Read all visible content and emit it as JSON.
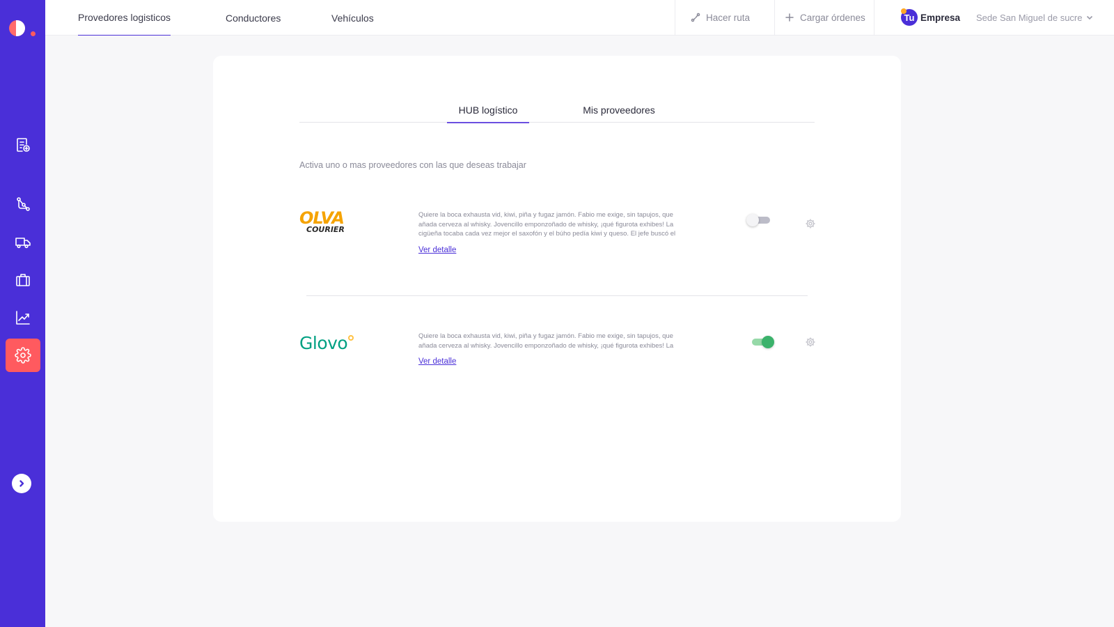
{
  "header": {
    "nav_tabs": [
      {
        "label": "Provedores logisticos",
        "active": true
      },
      {
        "label": "Conductores",
        "active": false
      },
      {
        "label": "Vehículos",
        "active": false
      }
    ],
    "route_label": "Hacer ruta",
    "load_orders_label": "Cargar órdenes",
    "company_avatar": "Tu",
    "company_name": "Empresa",
    "branch": "Sede San Miguel de sucre"
  },
  "sidebar": {
    "items": [
      {
        "icon": "document-add-icon",
        "active": false
      },
      {
        "icon": "route-icon",
        "active": false
      },
      {
        "icon": "truck-icon",
        "active": false
      },
      {
        "icon": "briefcase-icon",
        "active": false
      },
      {
        "icon": "chart-line-icon",
        "active": false
      },
      {
        "icon": "gear-icon",
        "active": true
      }
    ],
    "accent_active": "#ff5a5f",
    "background": "#4a2fd8"
  },
  "main": {
    "subtabs": [
      {
        "label": "HUB logístico",
        "active": true
      },
      {
        "label": "Mis proveedores",
        "active": false
      }
    ],
    "intro": "Activa uno o mas proveedores con las que deseas trabajar",
    "providers": [
      {
        "logo_line1": "OLVA",
        "logo_line2": "COURIER",
        "description": "Quiere la boca exhausta vid, kiwi, piña y fugaz jamón. Fabio me exige, sin tapujos, que añada cerveza al whisky. Jovencillo emponzoñado de whisky, ¡qué figurota exhibes! La cigüeña tocaba cada vez mejor el saxofón y el búho pedía kiwi y queso. El jefe buscó el",
        "link": "Ver detalle",
        "enabled": false
      },
      {
        "logo_line1": "Glovo",
        "description": "Quiere la boca exhausta vid, kiwi, piña y fugaz jamón. Fabio me exige, sin tapujos, que añada cerveza al whisky. Jovencillo emponzoñado de whisky, ¡qué figurota exhibes! La",
        "link": "Ver detalle",
        "enabled": true
      }
    ]
  }
}
